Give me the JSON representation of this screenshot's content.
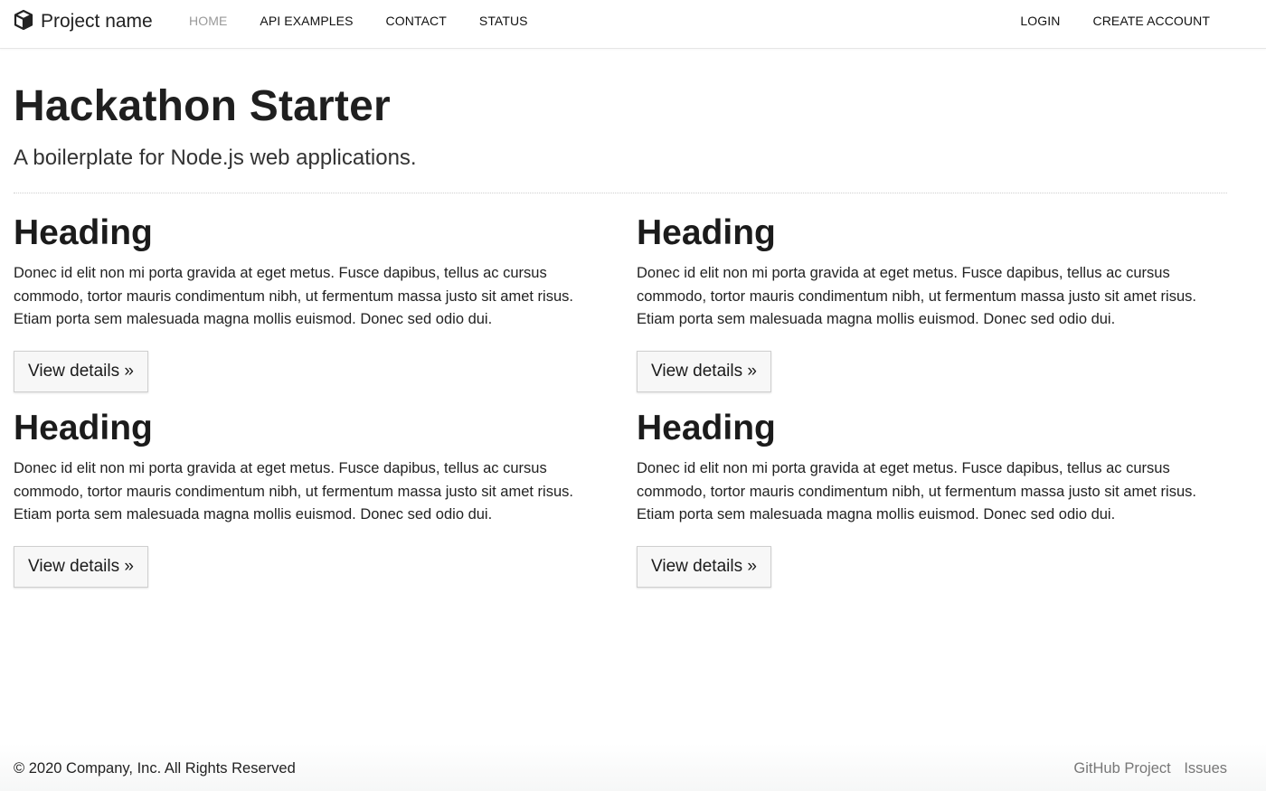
{
  "navbar": {
    "brand": {
      "icon": "cube-icon",
      "label": "Project name"
    },
    "left_links": [
      {
        "label": "Home",
        "active": true
      },
      {
        "label": "API Examples",
        "active": false
      },
      {
        "label": "Contact",
        "active": false
      },
      {
        "label": "Status",
        "active": false
      }
    ],
    "right_links": [
      {
        "label": "Login"
      },
      {
        "label": "Create Account"
      }
    ]
  },
  "hero": {
    "title": "Hackathon Starter",
    "subtitle": "A boilerplate for Node.js web applications."
  },
  "cards": [
    {
      "heading": "Heading",
      "body": "Donec id elit non mi porta gravida at eget metus. Fusce dapibus, tellus ac cursus commodo, tortor mauris condimentum nibh, ut fermentum massa justo sit amet risus. Etiam porta sem malesuada magna mollis euismod. Donec sed odio dui.",
      "button": "View details »"
    },
    {
      "heading": "Heading",
      "body": "Donec id elit non mi porta gravida at eget metus. Fusce dapibus, tellus ac cursus commodo, tortor mauris condimentum nibh, ut fermentum massa justo sit amet risus. Etiam porta sem malesuada magna mollis euismod. Donec sed odio dui.",
      "button": "View details »"
    },
    {
      "heading": "Heading",
      "body": "Donec id elit non mi porta gravida at eget metus. Fusce dapibus, tellus ac cursus commodo, tortor mauris condimentum nibh, ut fermentum massa justo sit amet risus. Etiam porta sem malesuada magna mollis euismod. Donec sed odio dui.",
      "button": "View details »"
    },
    {
      "heading": "Heading",
      "body": "Donec id elit non mi porta gravida at eget metus. Fusce dapibus, tellus ac cursus commodo, tortor mauris condimentum nibh, ut fermentum massa justo sit amet risus. Etiam porta sem malesuada magna mollis euismod. Donec sed odio dui.",
      "button": "View details »"
    }
  ],
  "footer": {
    "copyright": "© 2020 Company, Inc. All Rights Reserved",
    "links": [
      {
        "label": "GitHub Project"
      },
      {
        "label": "Issues"
      }
    ]
  },
  "colors": {
    "active_nav": "#999999",
    "text": "#222222",
    "footer_link": "#777777"
  }
}
